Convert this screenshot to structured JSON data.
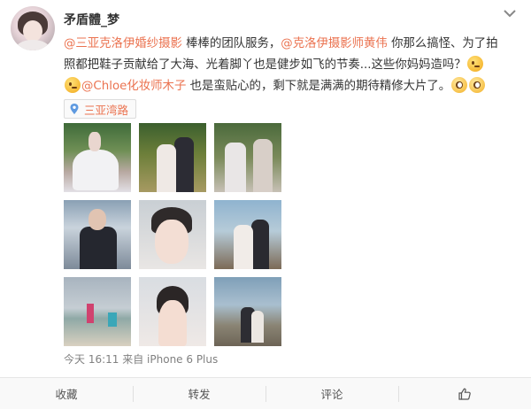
{
  "post": {
    "author": "矛盾體_梦",
    "text_lines": [
      {
        "parts": [
          {
            "type": "mention",
            "text": "@三亚克洛伊婚纱摄影"
          },
          {
            "type": "text",
            "text": " 棒棒的团队服务，"
          },
          {
            "type": "mention",
            "text": "@克洛伊摄影师黄伟"
          },
          {
            "type": "text",
            "text": " 你那么搞怪、为了拍"
          }
        ]
      },
      {
        "parts": [
          {
            "type": "text",
            "text": "照都把鞋子贡献给了大海、光着脚丫也是健步如飞的节奏...这些你妈妈造吗？"
          }
        ]
      },
      {
        "parts": [
          {
            "type": "mention",
            "text": "@Chloe化妆师木子"
          },
          {
            "type": "text",
            "text": " 也是蛮贴心的，剩下就是满满的期待精修大片了。"
          }
        ]
      }
    ],
    "location": "三亚湾路",
    "timestamp": "今天 16:11",
    "source": "来自 iPhone 6 Plus",
    "photos": [
      "photo-1",
      "photo-2",
      "photo-3",
      "photo-4",
      "photo-5",
      "photo-6",
      "photo-7",
      "photo-8",
      "photo-9"
    ]
  },
  "actions": {
    "favorite": "收藏",
    "repost": "转发",
    "comment": "评论",
    "like_icon": "thumbs-up-icon"
  },
  "icons": {
    "menu": "chevron-down-icon",
    "location": "location-pin-icon"
  },
  "colors": {
    "link": "#eb7350",
    "text": "#333333",
    "meta": "#808080"
  }
}
